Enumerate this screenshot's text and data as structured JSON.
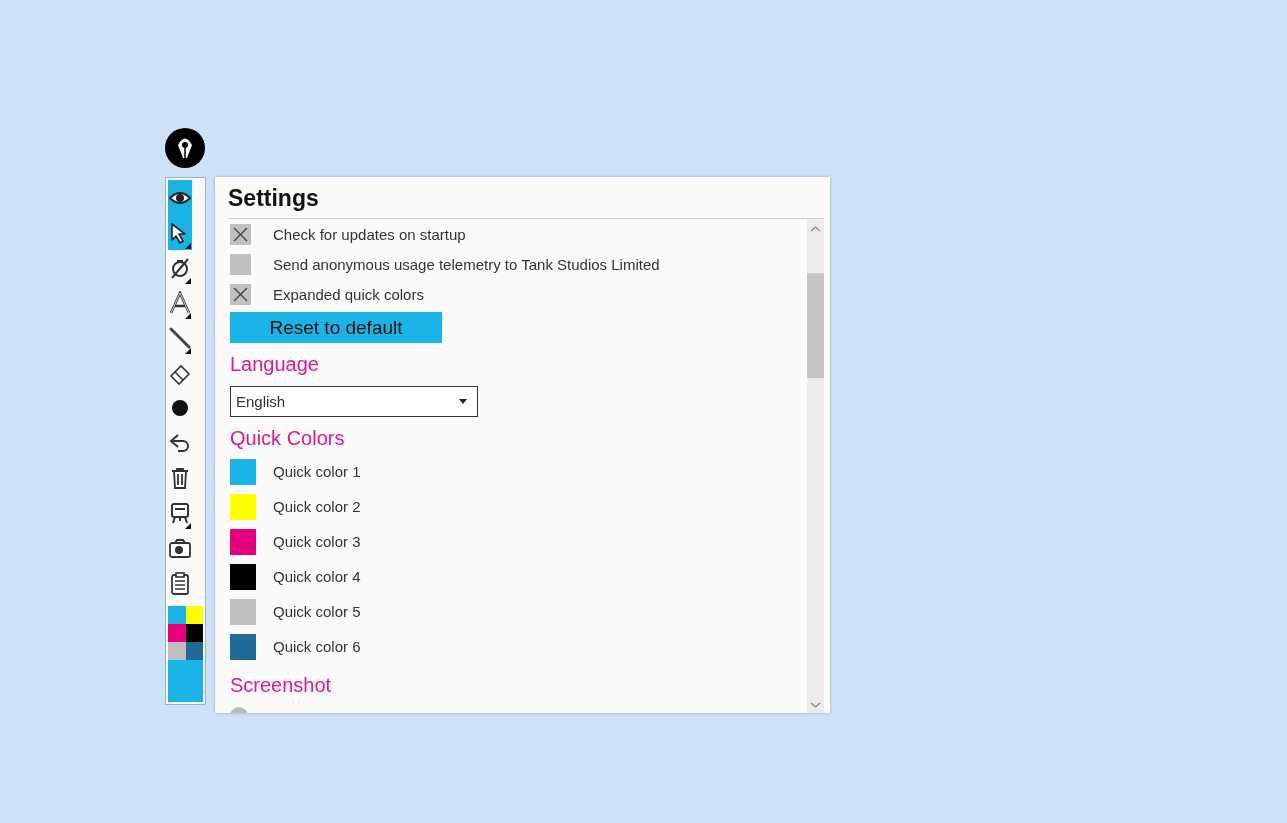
{
  "toolbar": {
    "tools": [
      {
        "kind": "eye",
        "selected": true,
        "submenu": false
      },
      {
        "kind": "pointer",
        "selected": true,
        "submenu": true
      },
      {
        "kind": "pen-off",
        "selected": false,
        "submenu": true
      },
      {
        "kind": "text",
        "selected": false,
        "submenu": true
      },
      {
        "kind": "line",
        "selected": false,
        "submenu": true
      },
      {
        "kind": "eraser",
        "selected": false,
        "submenu": false
      },
      {
        "kind": "dot",
        "selected": false,
        "submenu": false
      },
      {
        "kind": "undo",
        "selected": false,
        "submenu": false
      },
      {
        "kind": "trash",
        "selected": false,
        "submenu": false
      },
      {
        "kind": "board",
        "selected": false,
        "submenu": true
      },
      {
        "kind": "camera",
        "selected": false,
        "submenu": false
      },
      {
        "kind": "clipboard",
        "selected": false,
        "submenu": false
      }
    ],
    "palette": [
      {
        "color": "#1ab4e6"
      },
      {
        "color": "#ffff00"
      },
      {
        "color": "#e6007e"
      },
      {
        "color": "#000000"
      },
      {
        "color": "#c0c0c0"
      },
      {
        "color": "#1f6a96"
      }
    ],
    "current_color": {
      "color": "#1ab4e6"
    }
  },
  "settings": {
    "title": "Settings",
    "options": [
      {
        "label": "Check for updates on startup",
        "checked": true
      },
      {
        "label": "Send anonymous usage telemetry to Tank Studios Limited",
        "checked": false
      },
      {
        "label": "Expanded quick colors",
        "checked": true
      }
    ],
    "reset_button": "Reset to default",
    "language": {
      "heading": "Language",
      "value": "English"
    },
    "quick_colors": {
      "heading": "Quick Colors",
      "items": [
        {
          "label": "Quick color 1",
          "color": "#1ab4e6"
        },
        {
          "label": "Quick color 2",
          "color": "#ffff00"
        },
        {
          "label": "Quick color 3",
          "color": "#e6007e"
        },
        {
          "label": "Quick color 4",
          "color": "#000000"
        },
        {
          "label": "Quick color 5",
          "color": "#c0c0c0"
        },
        {
          "label": "Quick color 6",
          "color": "#1f6a96"
        }
      ]
    },
    "screenshot": {
      "heading": "Screenshot",
      "options": [
        {
          "selected": false
        }
      ]
    }
  }
}
